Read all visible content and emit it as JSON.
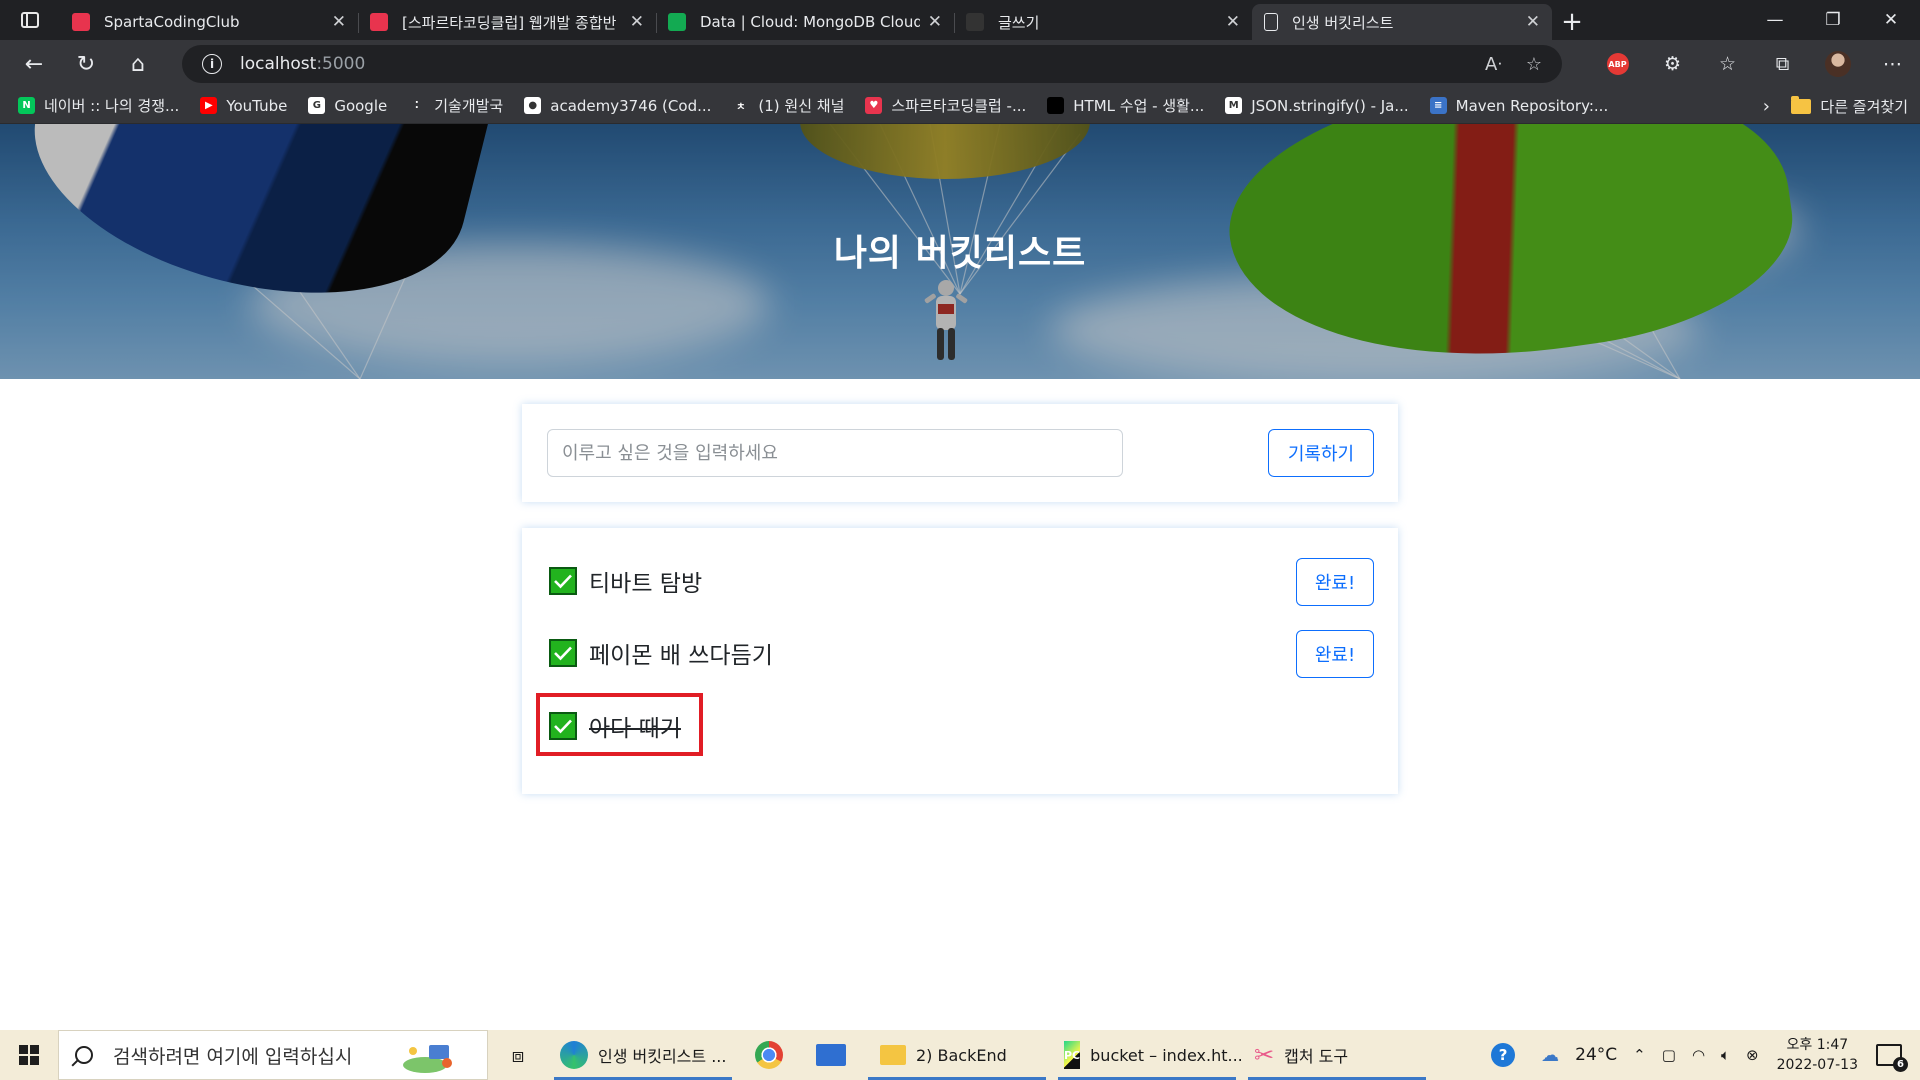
{
  "browser": {
    "tabs": [
      {
        "title": "SpartaCodingClub",
        "favicon_color": "#e8344e",
        "active": false
      },
      {
        "title": "[스파르타코딩클럽] 웹개발 종합반",
        "favicon_color": "#e8344e",
        "active": false
      },
      {
        "title": "Data | Cloud: MongoDB Cloud",
        "favicon_color": "#13aa52",
        "active": false
      },
      {
        "title": "글쓰기",
        "favicon_color": "#333333",
        "active": false
      },
      {
        "title": "인생 버킷리스트",
        "favicon_color": "#e8eaed",
        "active": true
      }
    ],
    "address": {
      "host": "localhost",
      "port": ":5000"
    },
    "bookmarks": [
      {
        "label": "네이버 :: 나의 경쟁...",
        "icon_color": "#03c75a",
        "glyph": "N"
      },
      {
        "label": "YouTube",
        "icon_color": "#ff0000",
        "glyph": "▶"
      },
      {
        "label": "Google",
        "icon_color": "#ffffff",
        "glyph": "G"
      },
      {
        "label": "기술개발국",
        "icon_color": "#35363a",
        "glyph": "⁚"
      },
      {
        "label": "academy3746 (Cod...",
        "icon_color": "#ffffff",
        "glyph": "●"
      },
      {
        "label": "(1) 원신 채널",
        "icon_color": "#35363a",
        "glyph": "ㅊ"
      },
      {
        "label": "스파르타코딩클럽 -...",
        "icon_color": "#e8344e",
        "glyph": "♥"
      },
      {
        "label": "HTML 수업 - 생활...",
        "icon_color": "#000000",
        "glyph": ""
      },
      {
        "label": "JSON.stringify() - Ja...",
        "icon_color": "#ffffff",
        "glyph": "M"
      },
      {
        "label": "Maven Repository:...",
        "icon_color": "#3b73c7",
        "glyph": "≡"
      }
    ],
    "other_bookmarks": "다른 즐겨찾기"
  },
  "page": {
    "title": "나의 버킷리스트",
    "input_placeholder": "이루고 싶은 것을 입력하세요",
    "input_value": "",
    "save_button": "기록하기",
    "items": [
      {
        "text": "티바트 탐방",
        "done": false,
        "button": "완료!"
      },
      {
        "text": "페이몬 배 쓰다듬기",
        "done": false,
        "button": "완료!"
      },
      {
        "text": "아다 때기",
        "done": true,
        "button": ""
      }
    ],
    "accent_color": "#0d6efd"
  },
  "taskbar": {
    "search_placeholder": "검색하려면 여기에 입력하십시",
    "apps": [
      {
        "label": "인생 버킷리스트 ...",
        "icon_color": "#1f7fd6",
        "open": true
      },
      {
        "label": "",
        "icon_color": "#e34133",
        "open": false
      },
      {
        "label": "",
        "icon_color": "#2f6fd1",
        "open": false
      },
      {
        "label": "2) BackEnd",
        "icon_color": "#f4c542",
        "open": true
      },
      {
        "label": "bucket – index.ht...",
        "icon_color": "#21d789",
        "open": true
      },
      {
        "label": "캡처 도구",
        "icon_color": "#e95a8a",
        "open": true
      }
    ],
    "temperature": "24°C",
    "time": "오후 1:47",
    "date": "2022-07-13",
    "notifications": "6"
  }
}
